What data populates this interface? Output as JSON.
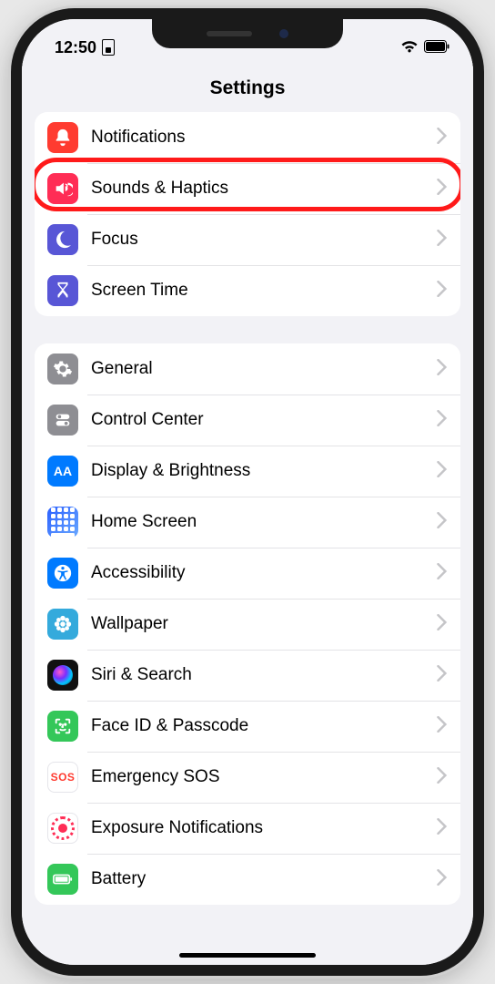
{
  "status": {
    "time": "12:50"
  },
  "header": {
    "title": "Settings"
  },
  "groups": [
    {
      "rows": [
        {
          "id": "notifications",
          "label": "Notifications",
          "icon": "bell-icon",
          "color": "#ff3b30"
        },
        {
          "id": "sounds-haptics",
          "label": "Sounds & Haptics",
          "icon": "speaker-icon",
          "color": "#ff2d55",
          "highlighted": true
        },
        {
          "id": "focus",
          "label": "Focus",
          "icon": "moon-icon",
          "color": "#5856d6"
        },
        {
          "id": "screen-time",
          "label": "Screen Time",
          "icon": "hourglass-icon",
          "color": "#5856d6"
        }
      ]
    },
    {
      "rows": [
        {
          "id": "general",
          "label": "General",
          "icon": "gear-icon",
          "color": "#8e8e93"
        },
        {
          "id": "control-center",
          "label": "Control Center",
          "icon": "switches-icon",
          "color": "#8e8e93"
        },
        {
          "id": "display-brightness",
          "label": "Display & Brightness",
          "icon": "text-size-icon",
          "color": "#007aff"
        },
        {
          "id": "home-screen",
          "label": "Home Screen",
          "icon": "home-grid-icon",
          "color": "#3478f6"
        },
        {
          "id": "accessibility",
          "label": "Accessibility",
          "icon": "accessibility-icon",
          "color": "#007aff"
        },
        {
          "id": "wallpaper",
          "label": "Wallpaper",
          "icon": "flower-icon",
          "color": "#34aadc"
        },
        {
          "id": "siri-search",
          "label": "Siri & Search",
          "icon": "siri-icon",
          "color": "#111111"
        },
        {
          "id": "face-id-passcode",
          "label": "Face ID & Passcode",
          "icon": "face-id-icon",
          "color": "#34c759"
        },
        {
          "id": "emergency-sos",
          "label": "Emergency SOS",
          "icon": "sos-icon",
          "color": "#ffffff",
          "text": "SOS"
        },
        {
          "id": "exposure-notifications",
          "label": "Exposure Notifications",
          "icon": "covid-icon",
          "color": "#ffffff"
        },
        {
          "id": "battery",
          "label": "Battery",
          "icon": "battery-icon",
          "color": "#34c759"
        }
      ]
    }
  ]
}
